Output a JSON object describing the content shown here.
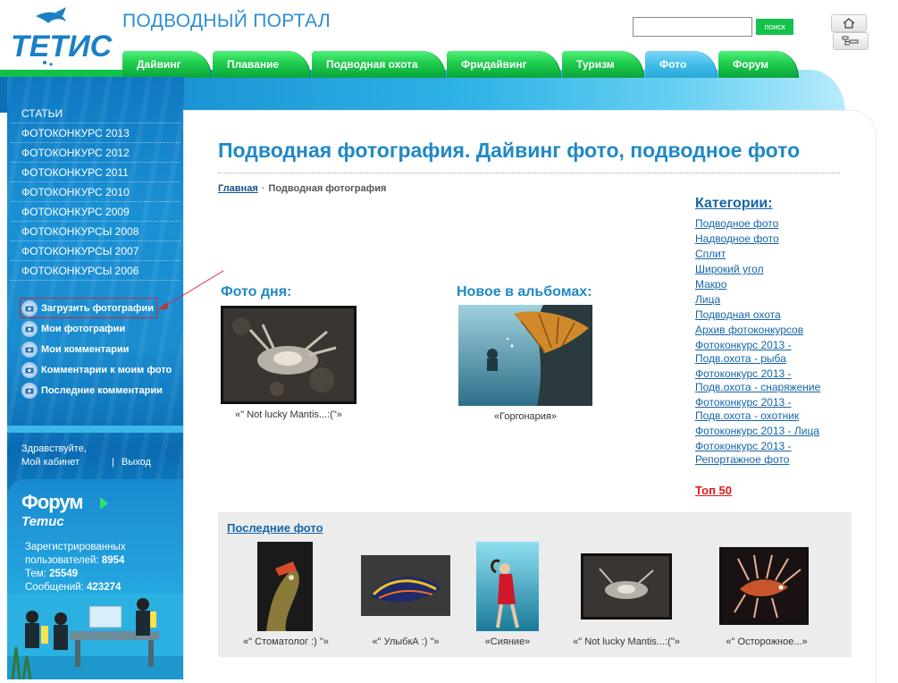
{
  "header": {
    "logo_text": "ТЕТИС",
    "portal_title": "ПОДВОДНЫЙ ПОРТАЛ",
    "search": {
      "placeholder": "",
      "value": "",
      "button_label": "поиск"
    }
  },
  "tabs": [
    {
      "label": "Дайвинг",
      "active": false
    },
    {
      "label": "Плавание",
      "active": false
    },
    {
      "label": "Подводная охота",
      "active": false
    },
    {
      "label": "Фридайвинг",
      "active": false
    },
    {
      "label": "Туризм",
      "active": false
    },
    {
      "label": "Фото",
      "active": true
    },
    {
      "label": "Форум",
      "active": false
    }
  ],
  "sidebar": {
    "sections": [
      {
        "label": "СТАТЬИ"
      },
      {
        "label": "ФОТОКОНКУРС 2013"
      },
      {
        "label": "ФОТОКОНКУРС 2012"
      },
      {
        "label": "ФОТОКОНКУРС 2011"
      },
      {
        "label": "ФОТОКОНКУРС 2010"
      },
      {
        "label": "ФОТОКОНКУРС 2009"
      },
      {
        "label": "ФОТОКОНКУРСЫ 2008"
      },
      {
        "label": "ФОТОКОНКУРСЫ 2007"
      },
      {
        "label": "ФОТОКОНКУРСЫ 2006"
      }
    ],
    "user_links": [
      {
        "label": "Загрузить фотографии"
      },
      {
        "label": "Мои фотографии"
      },
      {
        "label": "Мои комментарии"
      },
      {
        "label": "Комментарии к моим фото"
      },
      {
        "label": "Последние комментарии"
      }
    ],
    "greeting": "Здравствуйте,",
    "cabinet_label": "Мой кабинет",
    "separator": "|",
    "logout_label": "Выход",
    "forum": {
      "title": "Форум",
      "subtitle": "Тетис",
      "registered_label": "Зарегистрированных",
      "users_label": "пользователей:",
      "users_count": "8954",
      "topics_label": "Тем:",
      "topics_count": "25549",
      "messages_label": "Сообщений:",
      "messages_count": "423274"
    }
  },
  "main": {
    "title": "Подводная фотография. Дайвинг фото, подводное фото",
    "breadcrumb": {
      "home": "Главная",
      "separator": "·",
      "current": "Подводная фотография"
    },
    "photo_of_day": {
      "heading": "Фото дня:",
      "caption": "«\" Not lucky Mantis...:(\"»"
    },
    "new_in_albums": {
      "heading": "Новое в альбомах:",
      "caption": "«Горгонария»"
    },
    "categories": {
      "title": "Категории:",
      "items": [
        "Подводное фото",
        "Надводное фото",
        "Сплит",
        "Широкий угол",
        "Макро",
        "Лица",
        "Подводная охота",
        "Архив фотоконкурсов",
        "Фотоконкурс 2013 - Подв.охота - рыба",
        "Фотоконкурс 2013 - Подв.охота - снаряжение",
        "Фотоконкурс 2013 - Подв.охота - охотник",
        "Фотоконкурс 2013 - Лица",
        "Фотоконкурс 2013 - Репортажное фото"
      ],
      "top_label": "Топ 50"
    },
    "latest": {
      "heading": "Последние фото",
      "items": [
        {
          "caption": "«\" Стоматолог :) \"»"
        },
        {
          "caption": "«\" УлыбкА :) \"»"
        },
        {
          "caption": "«Сияние»"
        },
        {
          "caption": "«\" Not lucky Mantis...:(\"»"
        },
        {
          "caption": "«\" Осторожное...»"
        }
      ]
    }
  },
  "colors": {
    "tab_green": "#1fcd4d",
    "tab_active_blue": "#3dbce8",
    "title_blue": "#1f89c5",
    "link_blue": "#1565a8",
    "top_red": "#e01a1a",
    "highlight_red": "#d0282e"
  }
}
